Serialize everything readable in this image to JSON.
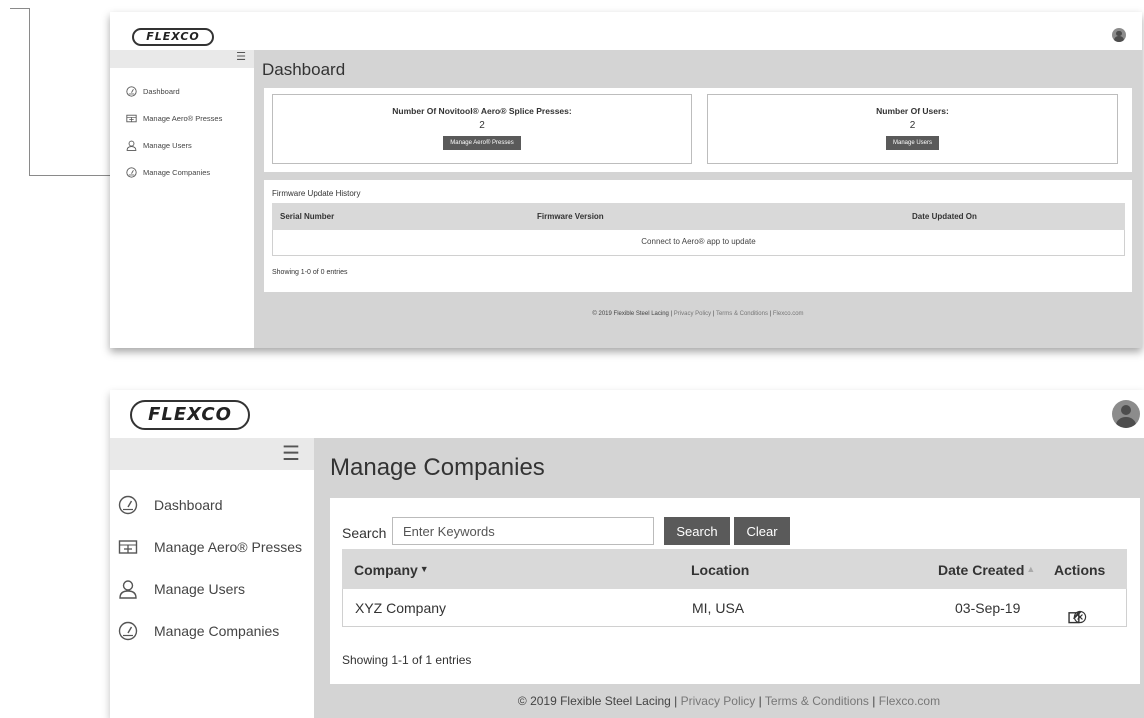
{
  "brand": {
    "logo_text": "FLEXCO"
  },
  "sidebar": {
    "items": [
      {
        "label": "Dashboard",
        "icon": "gauge-icon"
      },
      {
        "label": "Manage Aero® Presses",
        "icon": "press-icon"
      },
      {
        "label": "Manage Users",
        "icon": "user-icon"
      },
      {
        "label": "Manage Companies",
        "icon": "gauge-icon"
      }
    ]
  },
  "dashboard": {
    "title": "Dashboard",
    "cards": [
      {
        "label": "Number Of Novitool® Aero® Splice Presses:",
        "count": "2",
        "button": "Manage Aero® Presses"
      },
      {
        "label": "Number Of Users:",
        "count": "2",
        "button": "Manage Users"
      }
    ],
    "firmware": {
      "title": "Firmware Update History",
      "columns": [
        "Serial Number",
        "Firmware Version",
        "Date Updated On"
      ],
      "empty_message": "Connect to Aero® app to update",
      "showing": "Showing 1-0 of 0 entries"
    }
  },
  "companies": {
    "title": "Manage Companies",
    "search": {
      "label": "Search",
      "placeholder": "Enter Keywords",
      "search_button": "Search",
      "clear_button": "Clear"
    },
    "columns": {
      "company": "Company",
      "location": "Location",
      "date_created": "Date Created",
      "actions": "Actions"
    },
    "rows": [
      {
        "company": "XYZ Company",
        "location": "MI, USA",
        "date_created": "03-Sep-19"
      }
    ],
    "showing": "Showing 1-1 of 1 entries"
  },
  "footer": {
    "copyright": "© 2019 Flexible Steel Lacing",
    "sep": " | ",
    "links": [
      "Privacy Policy",
      "Terms & Conditions",
      "Flexco.com"
    ]
  },
  "colors": {
    "button": "#5a5a5a",
    "content_bg": "#d4d4d4",
    "table_header": "#d9d9d9"
  }
}
